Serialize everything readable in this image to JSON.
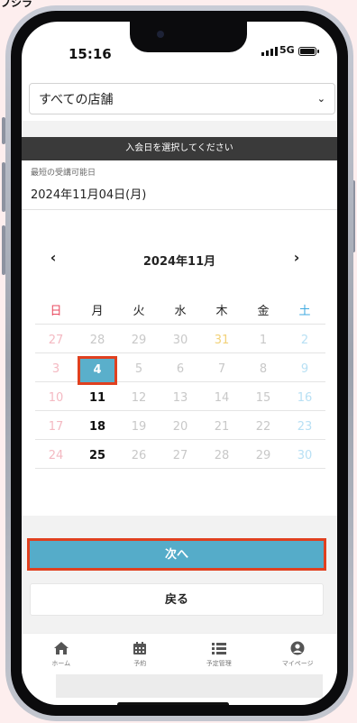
{
  "caption": "フシラ",
  "status": {
    "time": "15:16",
    "network": "5G"
  },
  "store_select": {
    "value": "すべての店舗"
  },
  "banner": "入会日を選択してください",
  "earliest": {
    "label": "最短の受講可能日",
    "date": "2024年11月04日(月)"
  },
  "calendar": {
    "title": "2024年11月",
    "prev": "‹",
    "next": "›",
    "weekdays": [
      "日",
      "月",
      "火",
      "水",
      "木",
      "金",
      "土"
    ],
    "weeks": [
      [
        "27",
        "28",
        "29",
        "30",
        "31",
        "1",
        "2"
      ],
      [
        "3",
        "4",
        "5",
        "6",
        "7",
        "8",
        "9"
      ],
      [
        "10",
        "11",
        "12",
        "13",
        "14",
        "15",
        "16"
      ],
      [
        "17",
        "18",
        "19",
        "20",
        "21",
        "22",
        "23"
      ],
      [
        "24",
        "25",
        "26",
        "27",
        "28",
        "29",
        "30"
      ]
    ],
    "selected": "4"
  },
  "buttons": {
    "next": "次へ",
    "back": "戻る"
  },
  "tabs": [
    {
      "label": "ホーム",
      "icon": "home-icon"
    },
    {
      "label": "予約",
      "icon": "calendar-icon"
    },
    {
      "label": "予定管理",
      "icon": "list-icon"
    },
    {
      "label": "マイページ",
      "icon": "user-icon"
    }
  ],
  "colors": {
    "accent": "#55acc9",
    "highlight": "#e0401f",
    "banner": "#3a3a3a"
  }
}
